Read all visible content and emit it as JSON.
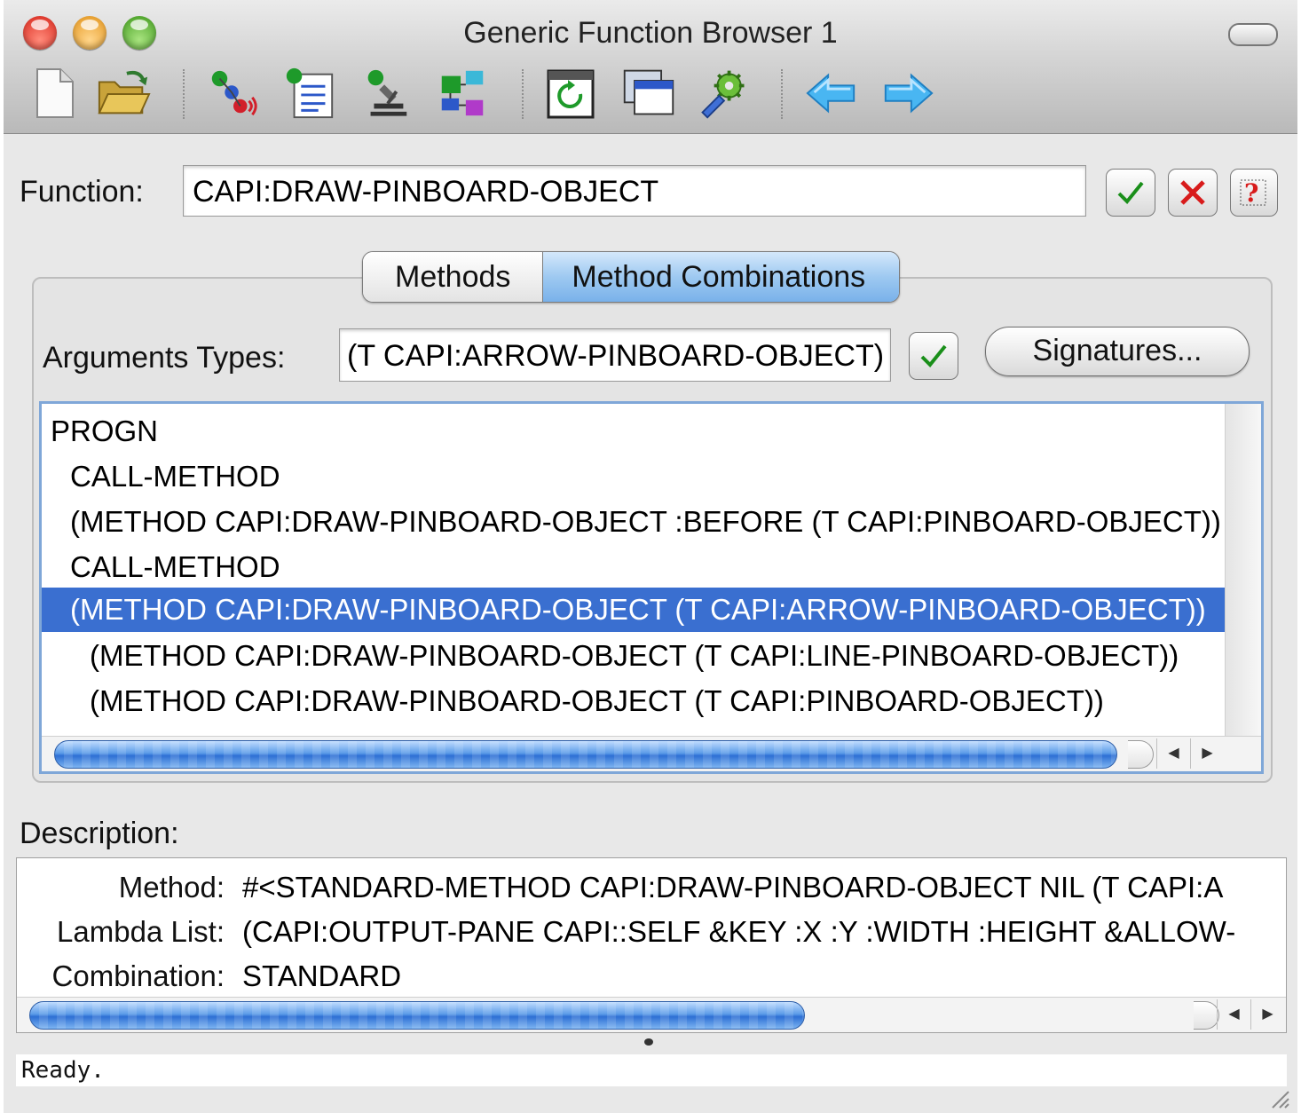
{
  "window": {
    "title": "Generic Function Browser 1"
  },
  "toolbar": {
    "items": [
      "new-document-icon",
      "open-folder-icon",
      "class-browser-icon",
      "listener-icon",
      "inspector-icon",
      "object-clipboard-icon",
      "refresh-icon",
      "new-window-icon",
      "preferences-icon",
      "back-arrow-icon",
      "forward-arrow-icon"
    ]
  },
  "function": {
    "label": "Function:",
    "value": "CAPI:DRAW-PINBOARD-OBJECT"
  },
  "tabs": [
    {
      "label": "Methods",
      "selected": false
    },
    {
      "label": "Method Combinations",
      "selected": true
    }
  ],
  "arguments": {
    "label": "Arguments Types:",
    "value": "(T CAPI:ARROW-PINBOARD-OBJECT)",
    "signatures_label": "Signatures..."
  },
  "combination_tree": {
    "rows": [
      {
        "text": "PROGN",
        "level": 0,
        "selected": false
      },
      {
        "text": "CALL-METHOD",
        "level": 1,
        "selected": false
      },
      {
        "text": "(METHOD CAPI:DRAW-PINBOARD-OBJECT :BEFORE (T CAPI:PINBOARD-OBJECT))",
        "level": 1,
        "selected": false
      },
      {
        "text": "CALL-METHOD",
        "level": 1,
        "selected": false
      },
      {
        "text": "(METHOD CAPI:DRAW-PINBOARD-OBJECT (T CAPI:ARROW-PINBOARD-OBJECT))",
        "level": 1,
        "selected": true
      },
      {
        "text": "(METHOD CAPI:DRAW-PINBOARD-OBJECT (T CAPI:LINE-PINBOARD-OBJECT))",
        "level": 2,
        "selected": false
      },
      {
        "text": "(METHOD CAPI:DRAW-PINBOARD-OBJECT (T CAPI:PINBOARD-OBJECT))",
        "level": 2,
        "selected": false
      }
    ]
  },
  "description": {
    "label": "Description:",
    "rows": [
      {
        "label": "Method:",
        "value": "#<STANDARD-METHOD CAPI:DRAW-PINBOARD-OBJECT NIL (T CAPI:A"
      },
      {
        "label": "Lambda List:",
        "value": "(CAPI:OUTPUT-PANE CAPI::SELF &KEY :X :Y :WIDTH :HEIGHT &ALLOW-"
      },
      {
        "label": "Combination:",
        "value": "STANDARD"
      }
    ]
  },
  "status": {
    "text": "Ready."
  },
  "colors": {
    "selection": "#3a6fd0",
    "check_green": "#1a8f1a",
    "cancel_red": "#d81b1b"
  }
}
